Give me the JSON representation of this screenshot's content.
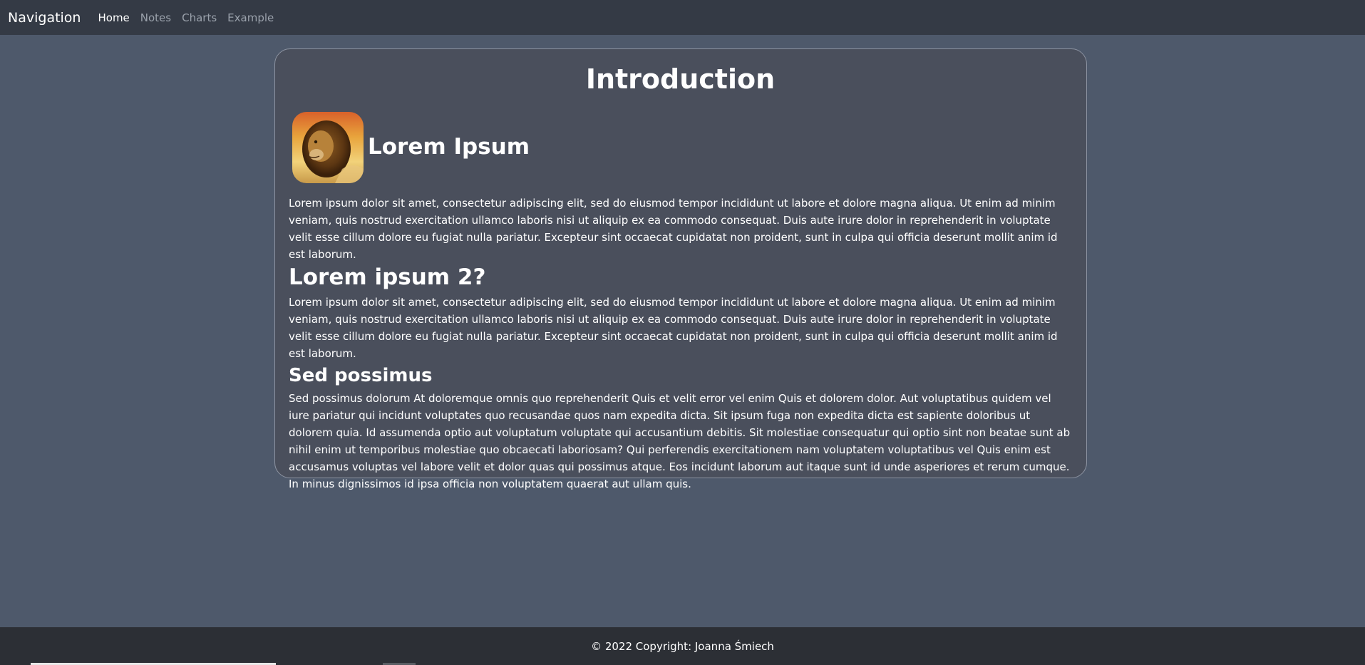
{
  "navbar": {
    "brand": "Navigation",
    "links": [
      {
        "label": "Home",
        "active": true
      },
      {
        "label": "Notes",
        "active": false
      },
      {
        "label": "Charts",
        "active": false
      },
      {
        "label": "Example",
        "active": false
      }
    ]
  },
  "main": {
    "title": "Introduction",
    "section1": {
      "heading": "Lorem Ipsum",
      "image_icon": "lion-image",
      "body": "Lorem ipsum dolor sit amet, consectetur adipiscing elit, sed do eiusmod tempor incididunt ut labore et dolore magna aliqua. Ut enim ad minim veniam, quis nostrud exercitation ullamco laboris nisi ut aliquip ex ea commodo consequat. Duis aute irure dolor in reprehenderit in voluptate velit esse cillum dolore eu fugiat nulla pariatur. Excepteur sint occaecat cupidatat non proident, sunt in culpa qui officia deserunt mollit anim id est laborum."
    },
    "section2": {
      "heading": "Lorem ipsum 2?",
      "body": "Lorem ipsum dolor sit amet, consectetur adipiscing elit, sed do eiusmod tempor incididunt ut labore et dolore magna aliqua. Ut enim ad minim veniam, quis nostrud exercitation ullamco laboris nisi ut aliquip ex ea commodo consequat. Duis aute irure dolor in reprehenderit in voluptate velit esse cillum dolore eu fugiat nulla pariatur. Excepteur sint occaecat cupidatat non proident, sunt in culpa qui officia deserunt mollit anim id est laborum."
    },
    "section3": {
      "heading": "Sed possimus",
      "body": "Sed possimus dolorum At doloremque omnis quo reprehenderit Quis et velit error vel enim Quis et dolorem dolor. Aut voluptatibus quidem vel iure pariatur qui incidunt voluptates quo recusandae quos nam expedita dicta. Sit ipsum fuga non expedita dicta est sapiente doloribus ut dolorem quia. Id assumenda optio aut voluptatum voluptate qui accusantium debitis. Sit molestiae consequatur qui optio sint non beatae sunt ab nihil enim ut temporibus molestiae quo obcaecati laboriosam? Qui perferendis exercitationem nam voluptatem voluptatibus vel Quis enim est accusamus voluptas vel labore velit et dolor quas qui possimus atque. Eos incidunt laborum aut itaque sunt id unde asperiores et rerum cumque. In minus dignissimos id ipsa officia non voluptatem quaerat aut ullam quis."
    }
  },
  "footer": {
    "text": "© 2022 Copyright: Joanna Śmiech"
  },
  "colors": {
    "page_background": "#4e596b",
    "navbar": "#343a45",
    "card": "#4a4f5c",
    "footer": "#2c2f35"
  }
}
